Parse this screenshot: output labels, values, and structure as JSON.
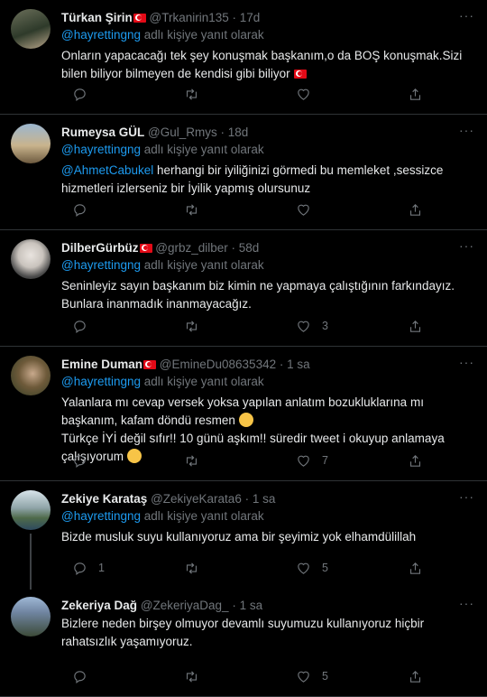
{
  "colors": {
    "background": "#000000",
    "accent": "#1d9bf0",
    "muted": "#71767b",
    "text": "#e7e9ea",
    "flag": "#e30a17"
  },
  "reply_suffix": "adlı kişiye yanıt olarak",
  "tweets": [
    {
      "name": "Türkan Şirin",
      "flag": true,
      "handle": "@Trkanirin135",
      "time": "17d",
      "reply_to": "@hayrettingng",
      "lines": [
        {
          "text": "Onların yapacacağı tek şey konuşmak başkanım,o da BOŞ konuşmak.Sizi"
        },
        {
          "text": "bilen biliyor bilmeyen de kendisi gibi biliyor",
          "emoji": "flag"
        }
      ],
      "counts": {
        "reply": "",
        "retweet": "",
        "like": ""
      }
    },
    {
      "name": "Rumeysa GÜL",
      "flag": false,
      "handle": "@Gul_Rmys",
      "time": "18d",
      "reply_to": "@hayrettingng",
      "lines": [
        {
          "mention": "@AhmetCabukel",
          "text": " herhangi bir iyiliğinizi  görmedi bu memleket ,sessizce"
        },
        {
          "text": "hizmetleri izlerseniz  bir İyilik yapmış olursunuz"
        }
      ],
      "counts": {
        "reply": "",
        "retweet": "",
        "like": ""
      }
    },
    {
      "name": "DilberGürbüz",
      "flag": true,
      "handle": "@grbz_dilber",
      "time": "58d",
      "reply_to": "@hayrettingng",
      "lines": [
        {
          "text": "Seninleyiz sayın başkanım biz kimin ne yapmaya çalıştığının farkındayız."
        },
        {
          "text": "Bunlara inanmadık inanmayacağız."
        }
      ],
      "counts": {
        "reply": "",
        "retweet": "",
        "like": "3"
      }
    },
    {
      "name": "Emine Duman",
      "flag": true,
      "handle": "@EmineDu08635342",
      "time": "1 sa",
      "reply_to": "@hayrettingng",
      "lines": [
        {
          "text": "Yalanlara mı cevap versek yoksa yapılan anlatım bozukluklarına mı"
        },
        {
          "text": "başkanım, kafam döndü resmen",
          "emoji": "face"
        },
        {
          "text": "Türkçe İYİ değil sıfır!! 10 günü aşkım!! süredir tweet i okuyup anlamaya"
        },
        {
          "text": "çalışıyorum",
          "emoji": "face"
        }
      ],
      "counts": {
        "reply": "",
        "retweet": "",
        "like": "7"
      }
    },
    {
      "name": "Zekiye Karataş",
      "flag": false,
      "handle": "@ZekiyeKarata6",
      "time": "1 sa",
      "reply_to": "@hayrettingng",
      "lines": [
        {
          "text": "Bizde musluk suyu kullanıyoruz ama bir şeyimiz yok elhamdülillah"
        }
      ],
      "counts": {
        "reply": "1",
        "retweet": "",
        "like": "5"
      },
      "thread": true
    },
    {
      "name": "Zekeriya Dağ",
      "flag": false,
      "handle": "@ZekeriyaDag_",
      "time": "1 sa",
      "reply_to": "",
      "lines": [
        {
          "text": "Bizlere neden birşey olmuyor devamlı suyumuzu kullanıyoruz hiçbir"
        },
        {
          "text": "rahatsızlık yaşamıyoruz."
        }
      ],
      "counts": {
        "reply": "",
        "retweet": "",
        "like": "5"
      }
    }
  ]
}
